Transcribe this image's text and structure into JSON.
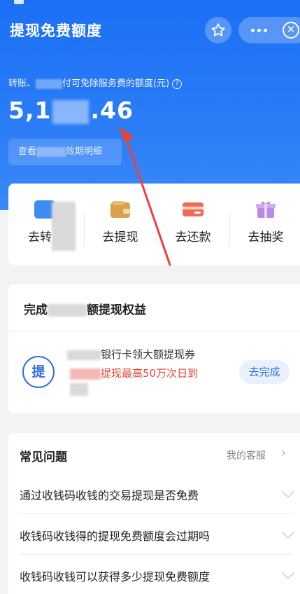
{
  "header": {
    "title": "提现免费额度",
    "star_icon": "star-outline-icon",
    "more_icon": "more-dots-icon",
    "close_icon": "close-circle-icon",
    "close_glyph": "✕"
  },
  "quota": {
    "label_prefix": "转账、",
    "label_suffix": "付可免除服务费的额度(元)",
    "help_glyph": "?",
    "amount_prefix": "5,1",
    "amount_suffix": ".46",
    "chevron": "›",
    "detail_prefix": "查看",
    "detail_suffix": "效期明细"
  },
  "actions": [
    {
      "label": "去转",
      "icon": "transfer-icon"
    },
    {
      "label": "去提现",
      "icon": "wallet-icon",
      "color": "#d9a14e"
    },
    {
      "label": "去还款",
      "icon": "card-icon",
      "color": "#f06a55"
    },
    {
      "label": "去抽奖",
      "icon": "gift-icon",
      "color": "#b88be8"
    }
  ],
  "benefit": {
    "title_prefix": "完成",
    "title_suffix": "额提现权益",
    "badge": "提",
    "task_line1": "银行卡领大额提现券",
    "task_line2": "提现最高50万次日到",
    "button": "去完成"
  },
  "faq": {
    "title": "常见问题",
    "service_link": "我的客服",
    "service_chevron": "›",
    "items": [
      {
        "q": "通过收钱码收钱的交易提现是否免费"
      },
      {
        "q": "收钱码收钱得的提现免费额度会过期吗"
      },
      {
        "q": "收钱码收钱可以获得多少提现免费额度"
      }
    ]
  },
  "colors": {
    "brand_blue": "#1b6ff3",
    "accent_blue": "#2d6fe0",
    "warning_red": "#e2483d",
    "annotation_red": "#e8423a"
  }
}
